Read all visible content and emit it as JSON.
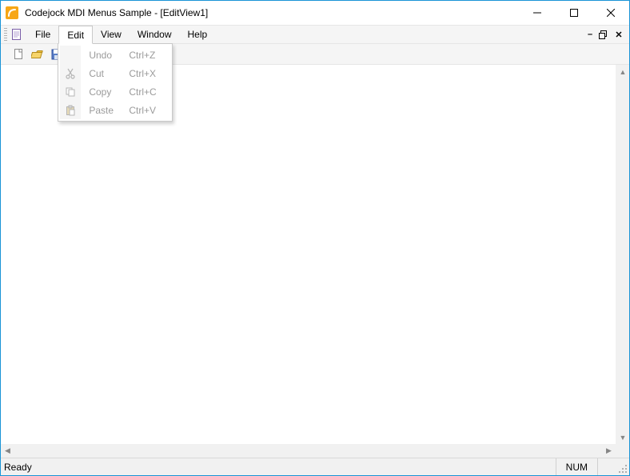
{
  "window": {
    "title": "Codejock MDI Menus Sample - [EditView1]"
  },
  "menubar": {
    "items": [
      "File",
      "Edit",
      "View",
      "Window",
      "Help"
    ]
  },
  "edit_menu": {
    "items": [
      {
        "label": "Undo",
        "shortcut": "Ctrl+Z",
        "icon": "undo-icon"
      },
      {
        "label": "Cut",
        "shortcut": "Ctrl+X",
        "icon": "cut-icon"
      },
      {
        "label": "Copy",
        "shortcut": "Ctrl+C",
        "icon": "copy-icon"
      },
      {
        "label": "Paste",
        "shortcut": "Ctrl+V",
        "icon": "paste-icon"
      }
    ]
  },
  "statusbar": {
    "ready": "Ready",
    "num": "NUM"
  }
}
